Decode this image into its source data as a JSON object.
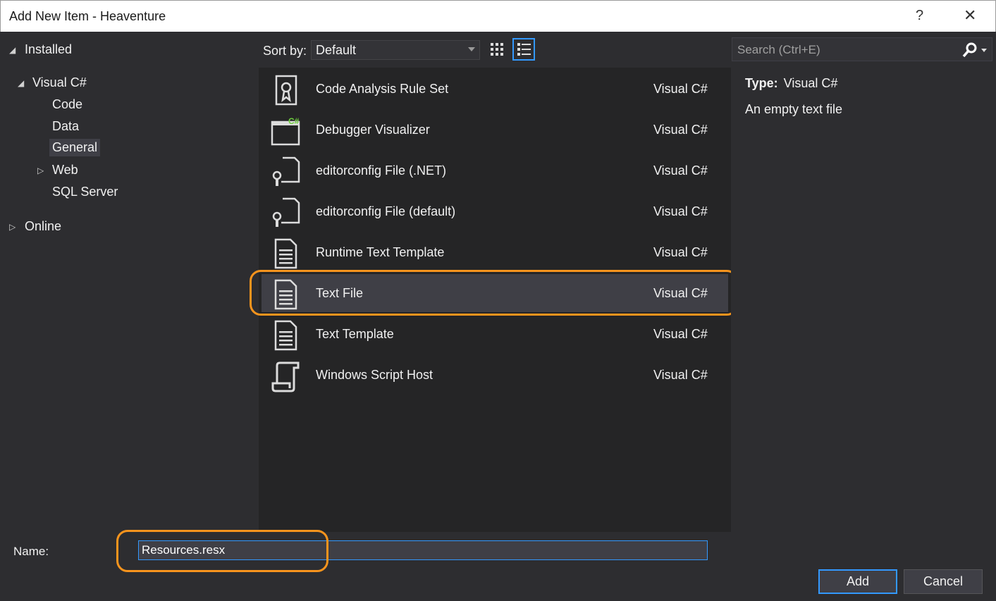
{
  "window": {
    "title": "Add New Item - Heaventure",
    "help": "?",
    "close": "✕"
  },
  "tree": {
    "installed": "Installed",
    "visual_csharp": "Visual C#",
    "code": "Code",
    "data": "Data",
    "general": "General",
    "web": "Web",
    "sql_server": "SQL Server",
    "online": "Online"
  },
  "toolbar": {
    "sort_label": "Sort by:",
    "sort_value": "Default"
  },
  "items": [
    {
      "name": "Code Analysis Rule Set",
      "lang": "Visual C#",
      "icon": "ribbon-icon"
    },
    {
      "name": "Debugger Visualizer",
      "lang": "Visual C#",
      "icon": "window-csharp-icon"
    },
    {
      "name": "editorconfig File (.NET)",
      "lang": "Visual C#",
      "icon": "config-wrench-icon"
    },
    {
      "name": "editorconfig File (default)",
      "lang": "Visual C#",
      "icon": "config-wrench-icon"
    },
    {
      "name": "Runtime Text Template",
      "lang": "Visual C#",
      "icon": "text-document-icon"
    },
    {
      "name": "Text File",
      "lang": "Visual C#",
      "icon": "text-document-icon",
      "selected": true
    },
    {
      "name": "Text Template",
      "lang": "Visual C#",
      "icon": "text-document-icon"
    },
    {
      "name": "Windows Script Host",
      "lang": "Visual C#",
      "icon": "script-scroll-icon"
    }
  ],
  "details": {
    "search_placeholder": "Search (Ctrl+E)",
    "type_label": "Type:",
    "type_value": "Visual C#",
    "description": "An empty text file"
  },
  "footer": {
    "name_label": "Name:",
    "name_value": "Resources.resx",
    "add_label": "Add",
    "cancel_label": "Cancel"
  },
  "colors": {
    "accent": "#3399ff",
    "highlight": "#f7941d",
    "background": "#2d2d30",
    "list_background": "#252526"
  }
}
